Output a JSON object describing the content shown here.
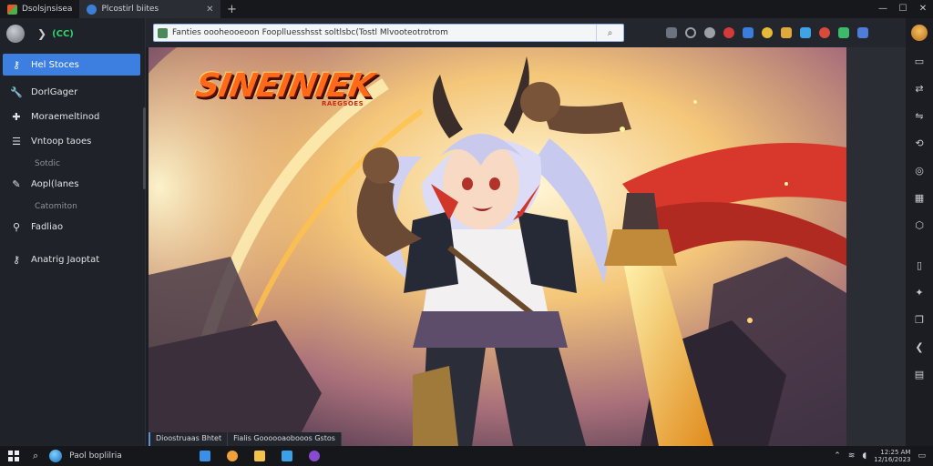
{
  "window": {
    "tabs": [
      {
        "label": "Dsolsjnsisea",
        "icon": "app-tile-icon",
        "active": false
      },
      {
        "label": "Plcostirl biites",
        "icon": "browser-icon",
        "active": true
      }
    ],
    "new_tab": "+",
    "controls": {
      "minimize": "—",
      "maximize": "☐",
      "close": "✕"
    }
  },
  "sidebar": {
    "status_text": "(CC)",
    "items": [
      {
        "label": "Hel Stoces",
        "icon": "key-icon",
        "active": true
      },
      {
        "label": "DorlGager",
        "icon": "wrench-icon",
        "active": false
      },
      {
        "label": "Moraemeltinod",
        "icon": "puzzle-icon",
        "active": false
      },
      {
        "label": "Vntoop taoes",
        "icon": "list-icon",
        "active": false,
        "sub": "Sotdic"
      },
      {
        "label": "Aopl(lanes",
        "icon": "brush-icon",
        "active": false,
        "sub": "Catomiton"
      },
      {
        "label": "Fadliao",
        "icon": "location-pin-icon",
        "active": false
      },
      {
        "label": "Anatrig Jaoptat",
        "icon": "key-icon",
        "active": false
      }
    ]
  },
  "toolbar": {
    "url": "Fanties oooheooeoon Fooplluesshsst soltlsbc(Tostl Mlvooteotrotrom",
    "search_icon": "search-icon",
    "extensions": [
      {
        "name": "camera-icon",
        "color": "#6b7280"
      },
      {
        "name": "ring-icon",
        "color": "#9aa0a6"
      },
      {
        "name": "gear-icon",
        "color": "#9aa0a6"
      },
      {
        "name": "bug-icon",
        "color": "#d33a3a"
      },
      {
        "name": "shield-icon",
        "color": "#3b7ddd"
      },
      {
        "name": "coin-icon",
        "color": "#e7b93a"
      },
      {
        "name": "folder-icon",
        "color": "#e0a93a"
      },
      {
        "name": "puzzle-icon",
        "color": "#3fa4e6"
      },
      {
        "name": "record-icon",
        "color": "#d84a3a"
      },
      {
        "name": "leaf-icon",
        "color": "#3dbb6a"
      },
      {
        "name": "blob-icon",
        "color": "#4d7dd8"
      }
    ]
  },
  "rightrail": {
    "icons": [
      "window-icon",
      "arrows-icon",
      "swap-icon",
      "refresh-icon",
      "compass-icon",
      "grid-icon",
      "cube-icon",
      "bracket-icon",
      "sparkle-icon",
      "copy-icon",
      "chevron-icon",
      "panel-icon"
    ]
  },
  "page": {
    "logo_text": "SINEINIEK",
    "logo_sub": "RAEGSOES"
  },
  "statusstrip": {
    "left": "Dioostruaas Bhtet",
    "right": "Fialis Goooooaobooos Gstos"
  },
  "taskbar": {
    "search_label": "Paol boplilria",
    "time": "12:25 AM",
    "date": "12/16/2023"
  }
}
